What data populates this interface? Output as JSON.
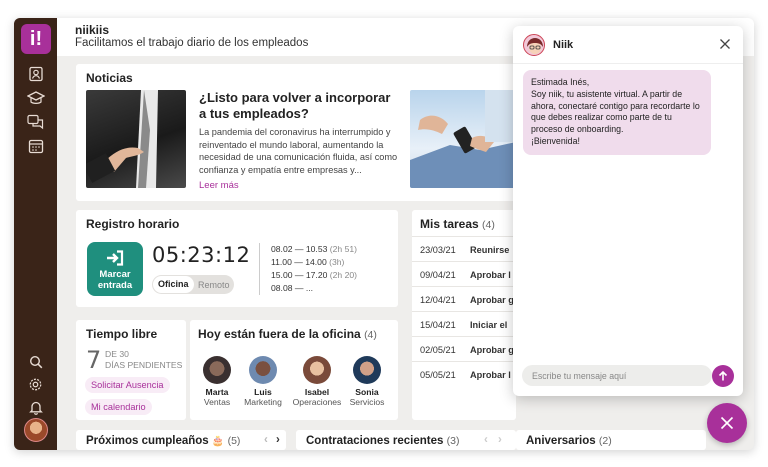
{
  "app": {
    "logo_text": "i!",
    "org_name": "niikiis",
    "slogan": "Facilitamos el trabajo diario de los empleados"
  },
  "sidebar": {
    "icons": [
      "profile-icon",
      "learning-icon",
      "chat-icon",
      "calendar-icon",
      "search-icon",
      "gear-icon",
      "bell-icon"
    ]
  },
  "news": {
    "title": "Noticias",
    "headline": "¿Listo para volver a incorporar a tus empleados?",
    "body": "La pandemia del coronavirus ha interrumpido y reinventado el mundo laboral, aumentando la necesidad de una comunicación fluida, así como confianza y empatía entre empresas y...",
    "read_more": "Leer más"
  },
  "time_tracking": {
    "title": "Registro horario",
    "clock_in_label": "Marcar entrada",
    "timer": "05:23:12",
    "mode_office": "Oficina",
    "mode_remote": "Remoto",
    "shifts": [
      {
        "range": "08.02 — 10.53",
        "duration": "(2h 51)"
      },
      {
        "range": "11.00 — 14.00",
        "duration": "(3h)"
      },
      {
        "range": "15.00 — 17.20",
        "duration": "(2h 20)"
      },
      {
        "range": "08.08 — ...",
        "duration": ""
      }
    ]
  },
  "tasks": {
    "title": "Mis tareas",
    "count": "(4)",
    "rows": [
      {
        "date": "23/03/21",
        "name": "Reunirse"
      },
      {
        "date": "09/04/21",
        "name": "Aprobar l"
      },
      {
        "date": "12/04/21",
        "name": "Aprobar g"
      },
      {
        "date": "15/04/21",
        "name": "Iniciar el"
      },
      {
        "date": "02/05/21",
        "name": "Aprobar g"
      },
      {
        "date": "05/05/21",
        "name": "Aprobar l"
      }
    ]
  },
  "leave": {
    "title": "Tiempo libre",
    "days": "7",
    "of_total": "DE 30",
    "pending": "DÍAS PENDIENTES",
    "request_label": "Solicitar Ausencia",
    "calendar_label": "Mi calendario"
  },
  "out_office": {
    "title": "Hoy están fuera de la oficina",
    "count": "(4)",
    "people": [
      {
        "name": "Marta",
        "dept": "Ventas"
      },
      {
        "name": "Luis",
        "dept": "Marketing"
      },
      {
        "name": "Isabel",
        "dept": "Operaciones"
      },
      {
        "name": "Sonia",
        "dept": "Servicios"
      }
    ]
  },
  "bottom": {
    "birthdays": "Próximos cumpleaños",
    "birthdays_count": "(5)",
    "hires": "Contrataciones recientes",
    "hires_count": "(3)",
    "anniversaries": "Aniversarios",
    "anniversaries_count": "(2)"
  },
  "chat": {
    "bot_name": "Niik",
    "message": "Estimada Inés,\nSoy niik, tu asistente virtual. A partir de ahora, conectaré contigo para recordarte lo que debes realizar como parte de tu proceso de onboarding.\n¡Bienvenida!",
    "input_placeholder": "Escribe tu mensaje aquí"
  },
  "colors": {
    "brand": "#a8309a",
    "sidebar": "#3a2418",
    "clock_button": "#1f8f7e",
    "bubble": "#f0dcec"
  }
}
